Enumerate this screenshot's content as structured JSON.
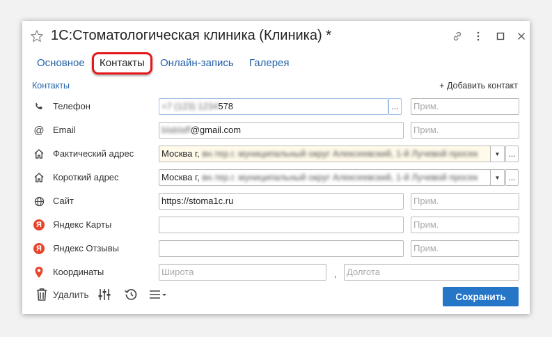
{
  "window": {
    "title": "1С:Стоматологическая клиника (Клиника) *",
    "icons": [
      "star-icon",
      "link-icon",
      "more-vertical-icon",
      "maximize-icon",
      "close-icon"
    ]
  },
  "tabs": [
    {
      "label": "Основное",
      "active": false
    },
    {
      "label": "Контакты",
      "active": true
    },
    {
      "label": "Онлайн-запись",
      "active": false
    },
    {
      "label": "Галерея",
      "active": false
    }
  ],
  "section": {
    "title": "Контакты",
    "add_contact": "+ Добавить контакт"
  },
  "rows": [
    {
      "label": "Телефон",
      "icon": "phone-icon",
      "value_hidden": "+7 (123) 1234",
      "value": "578",
      "note_placeholder": "Прим."
    },
    {
      "label": "Email",
      "icon": "at-icon",
      "value_hidden": "blablaff",
      "value": "@gmail.com",
      "note_placeholder": "Прим."
    },
    {
      "label": "Фактический адрес",
      "icon": "house-icon",
      "value": "Москва г,",
      "value_hidden": "вн.тер.г. муниципальный округ Алексеевский, 1-й Лучевой просек",
      "note_placeholder": ""
    },
    {
      "label": "Короткий адрес",
      "icon": "house-icon",
      "value": "Москва г,",
      "value_hidden": "вн.тер.г. муниципальный округ Алексеевский, 1-й Лучевой просек",
      "note_placeholder": ""
    },
    {
      "label": "Сайт",
      "icon": "globe-icon",
      "value": "https://stoma1c.ru",
      "note_placeholder": "Прим."
    },
    {
      "label": "Яндекс Карты",
      "icon": "yandex-icon",
      "value": "",
      "note_placeholder": "Прим."
    },
    {
      "label": "Яндекс Отзывы",
      "icon": "yandex-icon",
      "value": "",
      "note_placeholder": "Прим."
    },
    {
      "label": "Координаты",
      "icon": "map-pin-icon",
      "lat_placeholder": "Широта",
      "lon_placeholder": "Долгота",
      "separator": ","
    }
  ],
  "toolbar": {
    "delete_label": "Удалить",
    "save_label": "Сохранить"
  },
  "colors": {
    "accent": "#2676c8",
    "link": "#2561a8",
    "highlight": "#e4161b",
    "yandex": "#e8452c"
  }
}
